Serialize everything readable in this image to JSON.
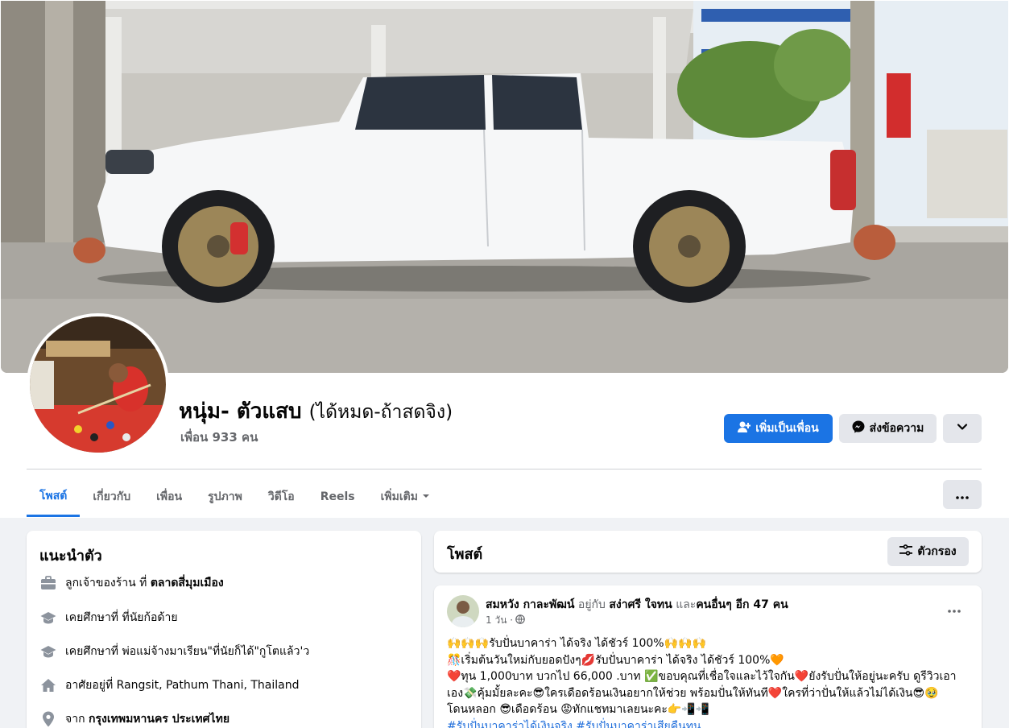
{
  "profile": {
    "name": "หนุ่ม- ตัวแสบ",
    "alt_name": "(ได้หมด-ถ้าสดจิง)",
    "friends": "เพื่อน 933 คน"
  },
  "actions": {
    "add_friend": "เพิ่มเป็นเพื่อน",
    "message": "ส่งข้อความ"
  },
  "tabs": [
    {
      "label": "โพสต์"
    },
    {
      "label": "เกี่ยวกับ"
    },
    {
      "label": "เพื่อน"
    },
    {
      "label": "รูปภาพ"
    },
    {
      "label": "วิดีโอ"
    },
    {
      "label": "Reels"
    },
    {
      "label": "เพิ่มเติม"
    }
  ],
  "intro": {
    "title": "แนะนำตัว",
    "items": [
      {
        "prefix": "ลูกเจ้าของร้าน ที่ ",
        "bold": "ตลาดสี่มุมเมือง"
      },
      {
        "prefix": "เคยศึกษาที่ ที่นัยก้อด้าย",
        "bold": ""
      },
      {
        "prefix": "เคยศึกษาที่ พ่อแม่จ้างมาเรียน\"ที่นัยก็ได้\"กูโตแล้ว'ว",
        "bold": ""
      },
      {
        "prefix": "อาศัยอยู่ที่ Rangsit, Pathum Thani, Thailand",
        "bold": ""
      },
      {
        "prefix": "จาก ",
        "bold": "กรุงเทพมหานคร ประเทศไทย"
      }
    ]
  },
  "posts": {
    "title": "โพสต์",
    "filter_label": "ตัวกรอง",
    "item": {
      "author": "สมหวัง กาละพัฒน์",
      "with_text": "อยู่กับ",
      "tagged": "สง่าศรี ใจทน",
      "and_text": "และ",
      "others": "คนอื่นๆ อีก 47 คน",
      "time": "1 วัน ·",
      "lines": [
        "🙌🙌🙌รับปั่นบาคาร่า ได้จริง ได้ชัวร์ 100%🙌🙌🙌",
        "🎊เริ่มต้นวันใหม่กับยอดปังๆ💋รับปั่นบาคาร่า ได้จริง ได้ชัวร์ 100%🧡",
        "❤️ทุน 1,000บาท บวกไป 66,000 .บาท ✅ขอบคุณที่เชื่อใจและไว้ใจกัน❤️ยังรับปั่นให้อยู่นะครับ ดูรีวิวเอา",
        "เอง💸คุ้มมั้ยละคะ😎ใครเดือดร้อนเงินอยากให้ช่วย พร้อมปั่นให้ทันที❤️ใครที่ว่าปั่นให้แล้วไม่ได้เงิน😎🥹",
        "โดนหลอก 😎เดือดร้อน 😡ทักแชทมาเลยนะคะ👉📲📲"
      ],
      "hashtags": "#รับปั่นบาคาร่าได้เงินจริง #รับปั่นบาคาร่าเสียคืนทุน"
    }
  },
  "colors": {
    "primary": "#1b74e4",
    "secondary_button": "#e4e6eb",
    "background": "#f0f2f5",
    "muted_text": "#65676b"
  }
}
